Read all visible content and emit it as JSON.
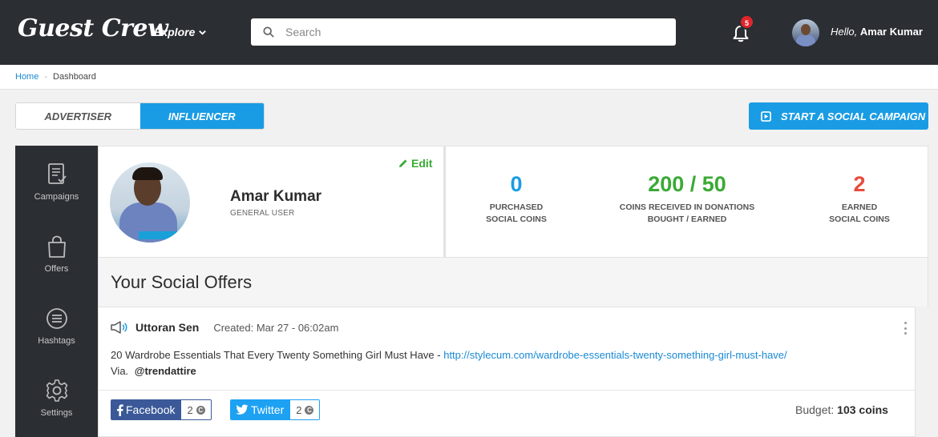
{
  "brand": {
    "logo_text": "Guest Crew",
    "accent": "#1a9ce4",
    "success": "#3aaa35",
    "danger": "#e74c3c"
  },
  "nav": {
    "explore_label": "Explore",
    "search_placeholder": "Search",
    "notification_count": "5",
    "greeting": "Hello,",
    "user_name": "Amar Kumar"
  },
  "breadcrumb": {
    "home": "Home",
    "current": "Dashboard"
  },
  "roles": {
    "advertiser": "ADVERTISER",
    "influencer": "INFLUENCER",
    "selected": "INFLUENCER"
  },
  "campaign_button": "START A SOCIAL CAMPAIGN",
  "sidebar": {
    "items": [
      {
        "label": "Campaigns",
        "icon": "document-icon"
      },
      {
        "label": "Offers",
        "icon": "shopping-bag-icon"
      },
      {
        "label": "Hashtags",
        "icon": "menu-circle-icon"
      },
      {
        "label": "Settings",
        "icon": "gear-icon"
      }
    ]
  },
  "profile": {
    "name": "Amar Kumar",
    "role": "GENERAL USER",
    "edit_label": "Edit"
  },
  "stats": [
    {
      "value": "0",
      "label1": "PURCHASED",
      "label2": "SOCIAL COINS",
      "color": "#1a9ce4"
    },
    {
      "value": "200 / 50",
      "label1": "COINS RECEIVED IN DONATIONS",
      "label2": "BOUGHT / EARNED",
      "color": "#3aaa35"
    },
    {
      "value": "2",
      "label1": "EARNED",
      "label2": "SOCIAL COINS",
      "color": "#e74c3c"
    }
  ],
  "offers": {
    "title": "Your Social Offers",
    "items": [
      {
        "user": "Uttoran Sen",
        "created": "Created: Mar 27 - 06:02am",
        "text": "20 Wardrobe Essentials That Every Twenty Something Girl Must Have - ",
        "link": "http://stylecum.com/wardrobe-essentials-twenty-something-girl-must-have/",
        "via_label": "Via.",
        "via_handle": "@trendattire",
        "facebook_label": "Facebook",
        "facebook_count": "2",
        "twitter_label": "Twitter",
        "twitter_count": "2",
        "budget_label": "Budget:",
        "budget_value": "103 coins"
      }
    ]
  }
}
